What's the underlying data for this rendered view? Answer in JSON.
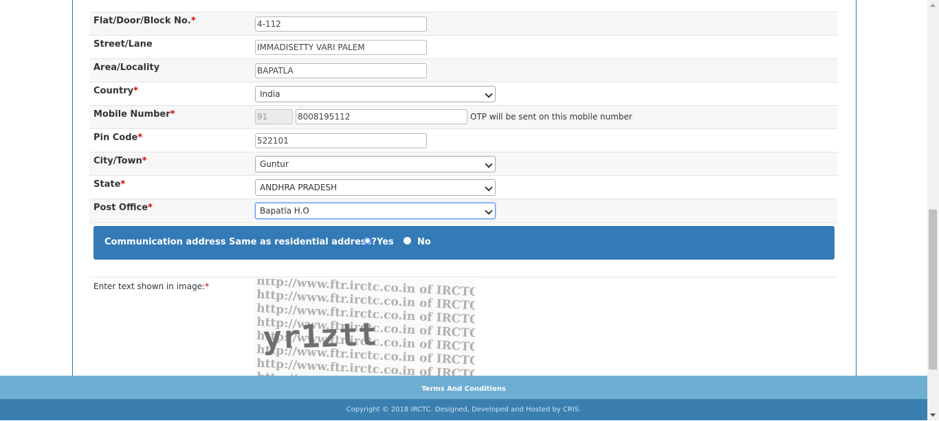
{
  "form": {
    "rows": [
      {
        "label": "Flat/Door/Block No.",
        "required": "*",
        "value": "4-112"
      },
      {
        "label": "Street/Lane",
        "required": "",
        "value": "IMMADISETTY VARI PALEM"
      },
      {
        "label": "Area/Locality",
        "required": "",
        "value": "BAPATLA"
      },
      {
        "label": "Country",
        "required": "*",
        "value": "India"
      },
      {
        "label": "Mobile Number",
        "required": "*",
        "country_code": "91",
        "value": "8008195112",
        "hint": "OTP will be sent on this mobile number"
      },
      {
        "label": "Pin Code",
        "required": "*",
        "value": "522101"
      },
      {
        "label": "City/Town",
        "required": "*",
        "value": "Guntur"
      },
      {
        "label": "State",
        "required": "*",
        "value": "ANDHRA PRADESH"
      },
      {
        "label": "Post Office",
        "required": "*",
        "value": "Bapatla H.O"
      }
    ],
    "communication": {
      "question": "Communication address Same as residential address?",
      "yes_label": "Yes",
      "no_label": "No"
    },
    "captcha": {
      "label": "Enter text shown in image:",
      "required": "*",
      "watermark": "http://www.ftr.irctc.co.in of IRCTC",
      "code": "yr1ztt"
    }
  },
  "footer": {
    "terms": "Terms And Conditions",
    "copyright": "Copyright © 2018 IRCTC. Designed, Developed and Hosted by CRIS."
  },
  "colors": {
    "banner": "#337ab7",
    "footer_top": "#6eaed3",
    "footer_bottom": "#3b7fb0",
    "required": "#cc0000"
  }
}
